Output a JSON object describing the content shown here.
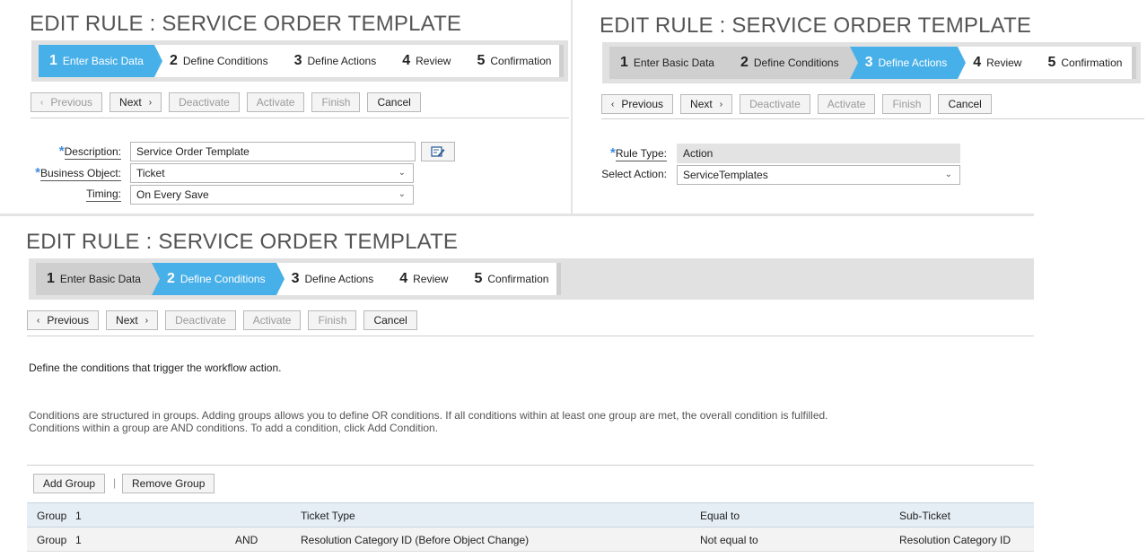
{
  "title": "EDIT RULE : SERVICE ORDER TEMPLATE",
  "steps": [
    {
      "num": "1",
      "label": "Enter Basic Data"
    },
    {
      "num": "2",
      "label": "Define Conditions"
    },
    {
      "num": "3",
      "label": "Define Actions"
    },
    {
      "num": "4",
      "label": "Review"
    },
    {
      "num": "5",
      "label": "Confirmation"
    }
  ],
  "toolbar": {
    "previous": "Previous",
    "next": "Next",
    "deactivate": "Deactivate",
    "activate": "Activate",
    "finish": "Finish",
    "cancel": "Cancel"
  },
  "basic": {
    "description_label": "Description:",
    "description_value": "Service Order Template",
    "business_object_label": "Business Object:",
    "business_object_value": "Ticket",
    "timing_label": "Timing:",
    "timing_value": "On Every Save"
  },
  "actions": {
    "rule_type_label": "Rule Type:",
    "rule_type_value": "Action",
    "select_action_label": "Select Action:",
    "select_action_value": "ServiceTemplates"
  },
  "conditions": {
    "intro": "Define the conditions that trigger the workflow action.",
    "help1": "Conditions are structured in groups. Adding groups allows you to define OR conditions. If all conditions within at least one group are met, the overall condition is fulfilled.",
    "help2": "Conditions within a group are AND conditions. To add a condition, click Add Condition.",
    "add_group": "Add Group",
    "remove_group": "Remove Group",
    "separator": "|",
    "rows": [
      {
        "group": "Group",
        "num": "1",
        "op": "",
        "field": "Ticket Type",
        "comparator": "Equal to",
        "value": "Sub-Ticket"
      },
      {
        "group": "Group",
        "num": "1",
        "op": "AND",
        "field": "Resolution Category ID (Before Object Change)",
        "comparator": "Not equal to",
        "value": "Resolution Category ID"
      }
    ]
  },
  "icons": {
    "prev": "chevron-left-icon",
    "next": "chevron-right-icon",
    "edit": "edit-icon",
    "dropdown": "chevron-down-icon"
  },
  "colors": {
    "active_step": "#48b0e8",
    "done_step": "#cfcfcf",
    "required": "#3f8ee0"
  }
}
